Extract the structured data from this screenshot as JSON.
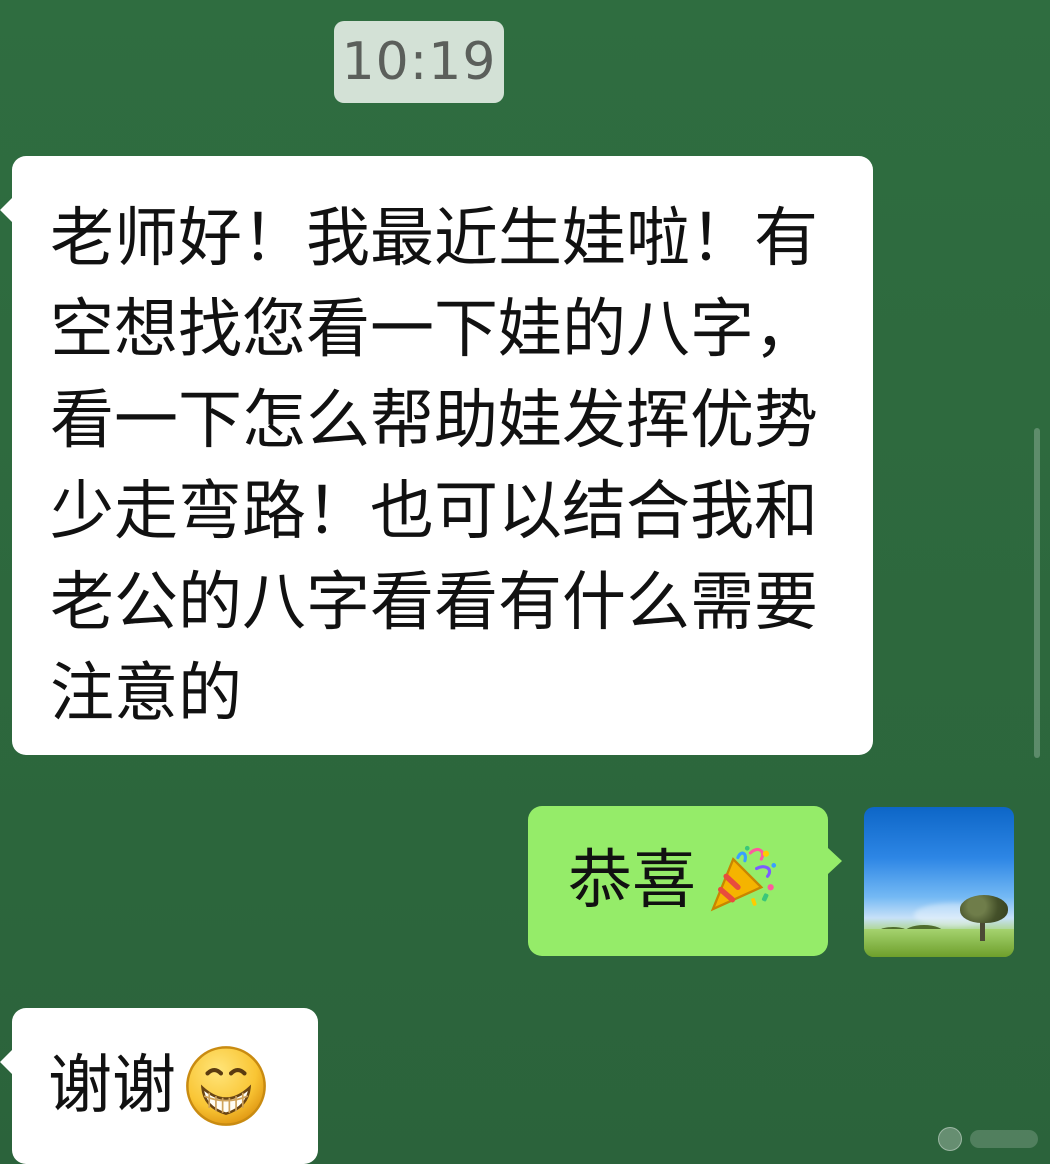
{
  "timestamp": "10:19",
  "messages": [
    {
      "text": "老师好！我最近生娃啦！有空想找您看一下娃的八字，看一下怎么帮助娃发挥优势 少走弯路！也可以结合我和老公的八字看看有什么需要注意的"
    },
    {
      "text": "恭喜",
      "emoji": "party-popper-icon"
    },
    {
      "text": "谢谢",
      "emoji": "grinning-face-icon"
    }
  ],
  "avatar": {
    "subject": "landscape-avatar"
  },
  "colors": {
    "background": "#2f6b3f",
    "incoming_bubble": "#ffffff",
    "outgoing_bubble": "#95ec69",
    "timestamp_bg": "#d3e1d6"
  }
}
